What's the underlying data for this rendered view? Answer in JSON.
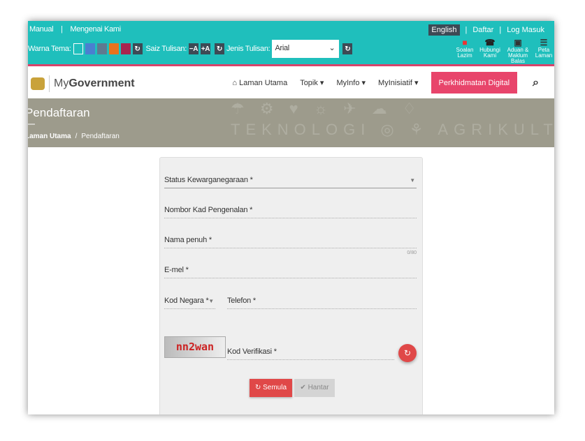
{
  "topbar": {
    "links": [
      "Manual",
      "|",
      "Mengenai Kami"
    ],
    "theme_label": "Warna Tema:",
    "theme_colors": [
      "#1fbfbc",
      "#4a7fd0",
      "#5f7a90",
      "#e8731c",
      "#a8244f"
    ],
    "font_size_label": "Saiz Tulisan:",
    "decrease": "−A",
    "increase": "+A",
    "font_type_label": "Jenis Tulisan:",
    "font_type_value": "Arial",
    "reset_icon": "refresh-icon",
    "lang": "English",
    "register": "Daftar",
    "login": "Log Masuk",
    "quick": [
      {
        "label": "Soalan Lazim",
        "icon": "faq-icon"
      },
      {
        "label": "Hubungi Kami",
        "icon": "phone-icon"
      },
      {
        "label": "Aduan & Maklum Balas",
        "icon": "feedback-icon"
      },
      {
        "label": "Peta Laman",
        "icon": "sitemap-icon"
      }
    ]
  },
  "nav": {
    "brand_pre": "My",
    "brand": "Government",
    "items": [
      "Laman Utama",
      "Topik ▾",
      "MyInfo ▾",
      "MyInisiatif ▾"
    ],
    "cta": "Perkhidmatan Digital"
  },
  "banner": {
    "title": "Pendaftaran",
    "breadcrumb": [
      "Laman Utama",
      "/",
      "Pendaftaran"
    ],
    "decor": [
      "TEKNOLOGI",
      "AGRIKULTUR"
    ]
  },
  "form": {
    "citizenship": "Status Kewarganegaraan *",
    "ic": "Nombor Kad Pengenalan *",
    "name": "Nama penuh *",
    "counter": "0/80",
    "email": "E-mel *",
    "country_code": "Kod Negara *",
    "phone": "Telefon *",
    "captcha_text": "nn2wan",
    "captcha": "Kod Verifikasi *",
    "reset": "Semula",
    "submit": "Hantar"
  },
  "colors": {
    "teal": "#1fbfbc",
    "pink": "#e8456b",
    "red": "#e04848"
  }
}
